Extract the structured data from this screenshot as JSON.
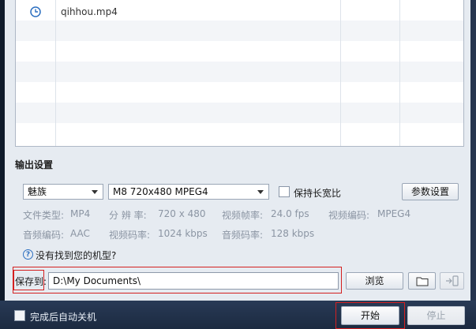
{
  "file_list": {
    "rows": [
      {
        "name": "qihhou.mp4",
        "icon": "clock-icon"
      }
    ]
  },
  "output": {
    "section_title": "输出设置",
    "device_value": "魅族",
    "format_value": "M8 720x480 MPEG4",
    "keep_ratio_label": "保持长宽比",
    "params_button": "参数设置",
    "info_row1": [
      {
        "label": "文件类型:",
        "value": "MP4"
      },
      {
        "label": "分 辨 率:",
        "value": "720 x 480"
      },
      {
        "label": "视频帧率:",
        "value": "24.0 fps"
      },
      {
        "label": "视频编码:",
        "value": "MPEG4"
      }
    ],
    "info_row2": [
      {
        "label": "音频编码:",
        "value": "AAC"
      },
      {
        "label": "视频码率:",
        "value": "1024 kbps"
      },
      {
        "label": "音频码率:",
        "value": "128 kbps"
      }
    ],
    "help_text": "没有找到您的机型?",
    "save_label": "保存到:",
    "save_path": "D:\\My Documents\\",
    "browse_button": "浏览"
  },
  "bottom": {
    "shutdown_label": "完成后自动关机",
    "start_button": "开始",
    "stop_button": "停止"
  },
  "colors": {
    "highlight_red": "#d42020",
    "dialog_bg": "#e6ebf1",
    "bottom_bar": "#1c2a40"
  }
}
